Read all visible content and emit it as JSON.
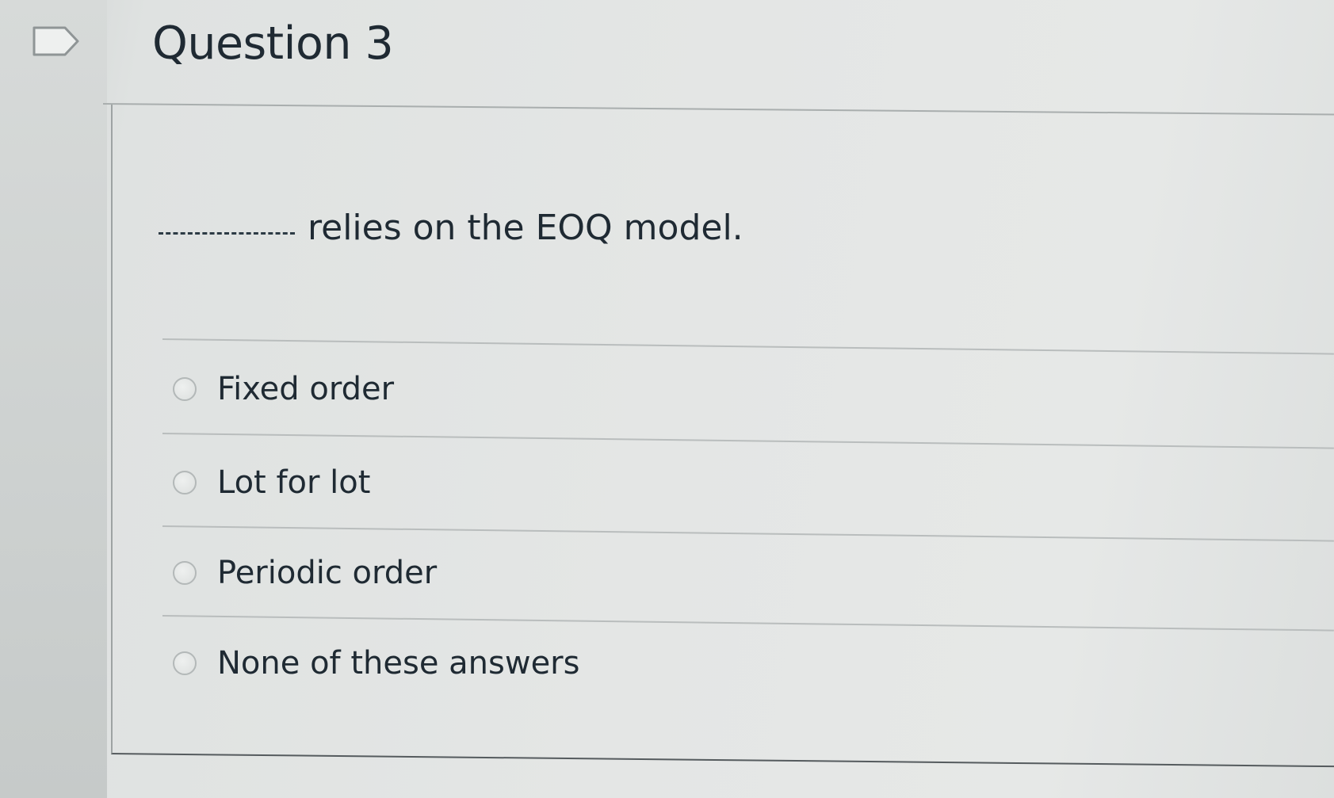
{
  "question": {
    "title": "Question 3",
    "prompt": "relies on the EOQ model."
  },
  "answers": [
    {
      "label": "Fixed order",
      "selected": false
    },
    {
      "label": "Lot for lot",
      "selected": false
    },
    {
      "label": "Periodic order",
      "selected": false
    },
    {
      "label": "None of these answers",
      "selected": false
    }
  ]
}
